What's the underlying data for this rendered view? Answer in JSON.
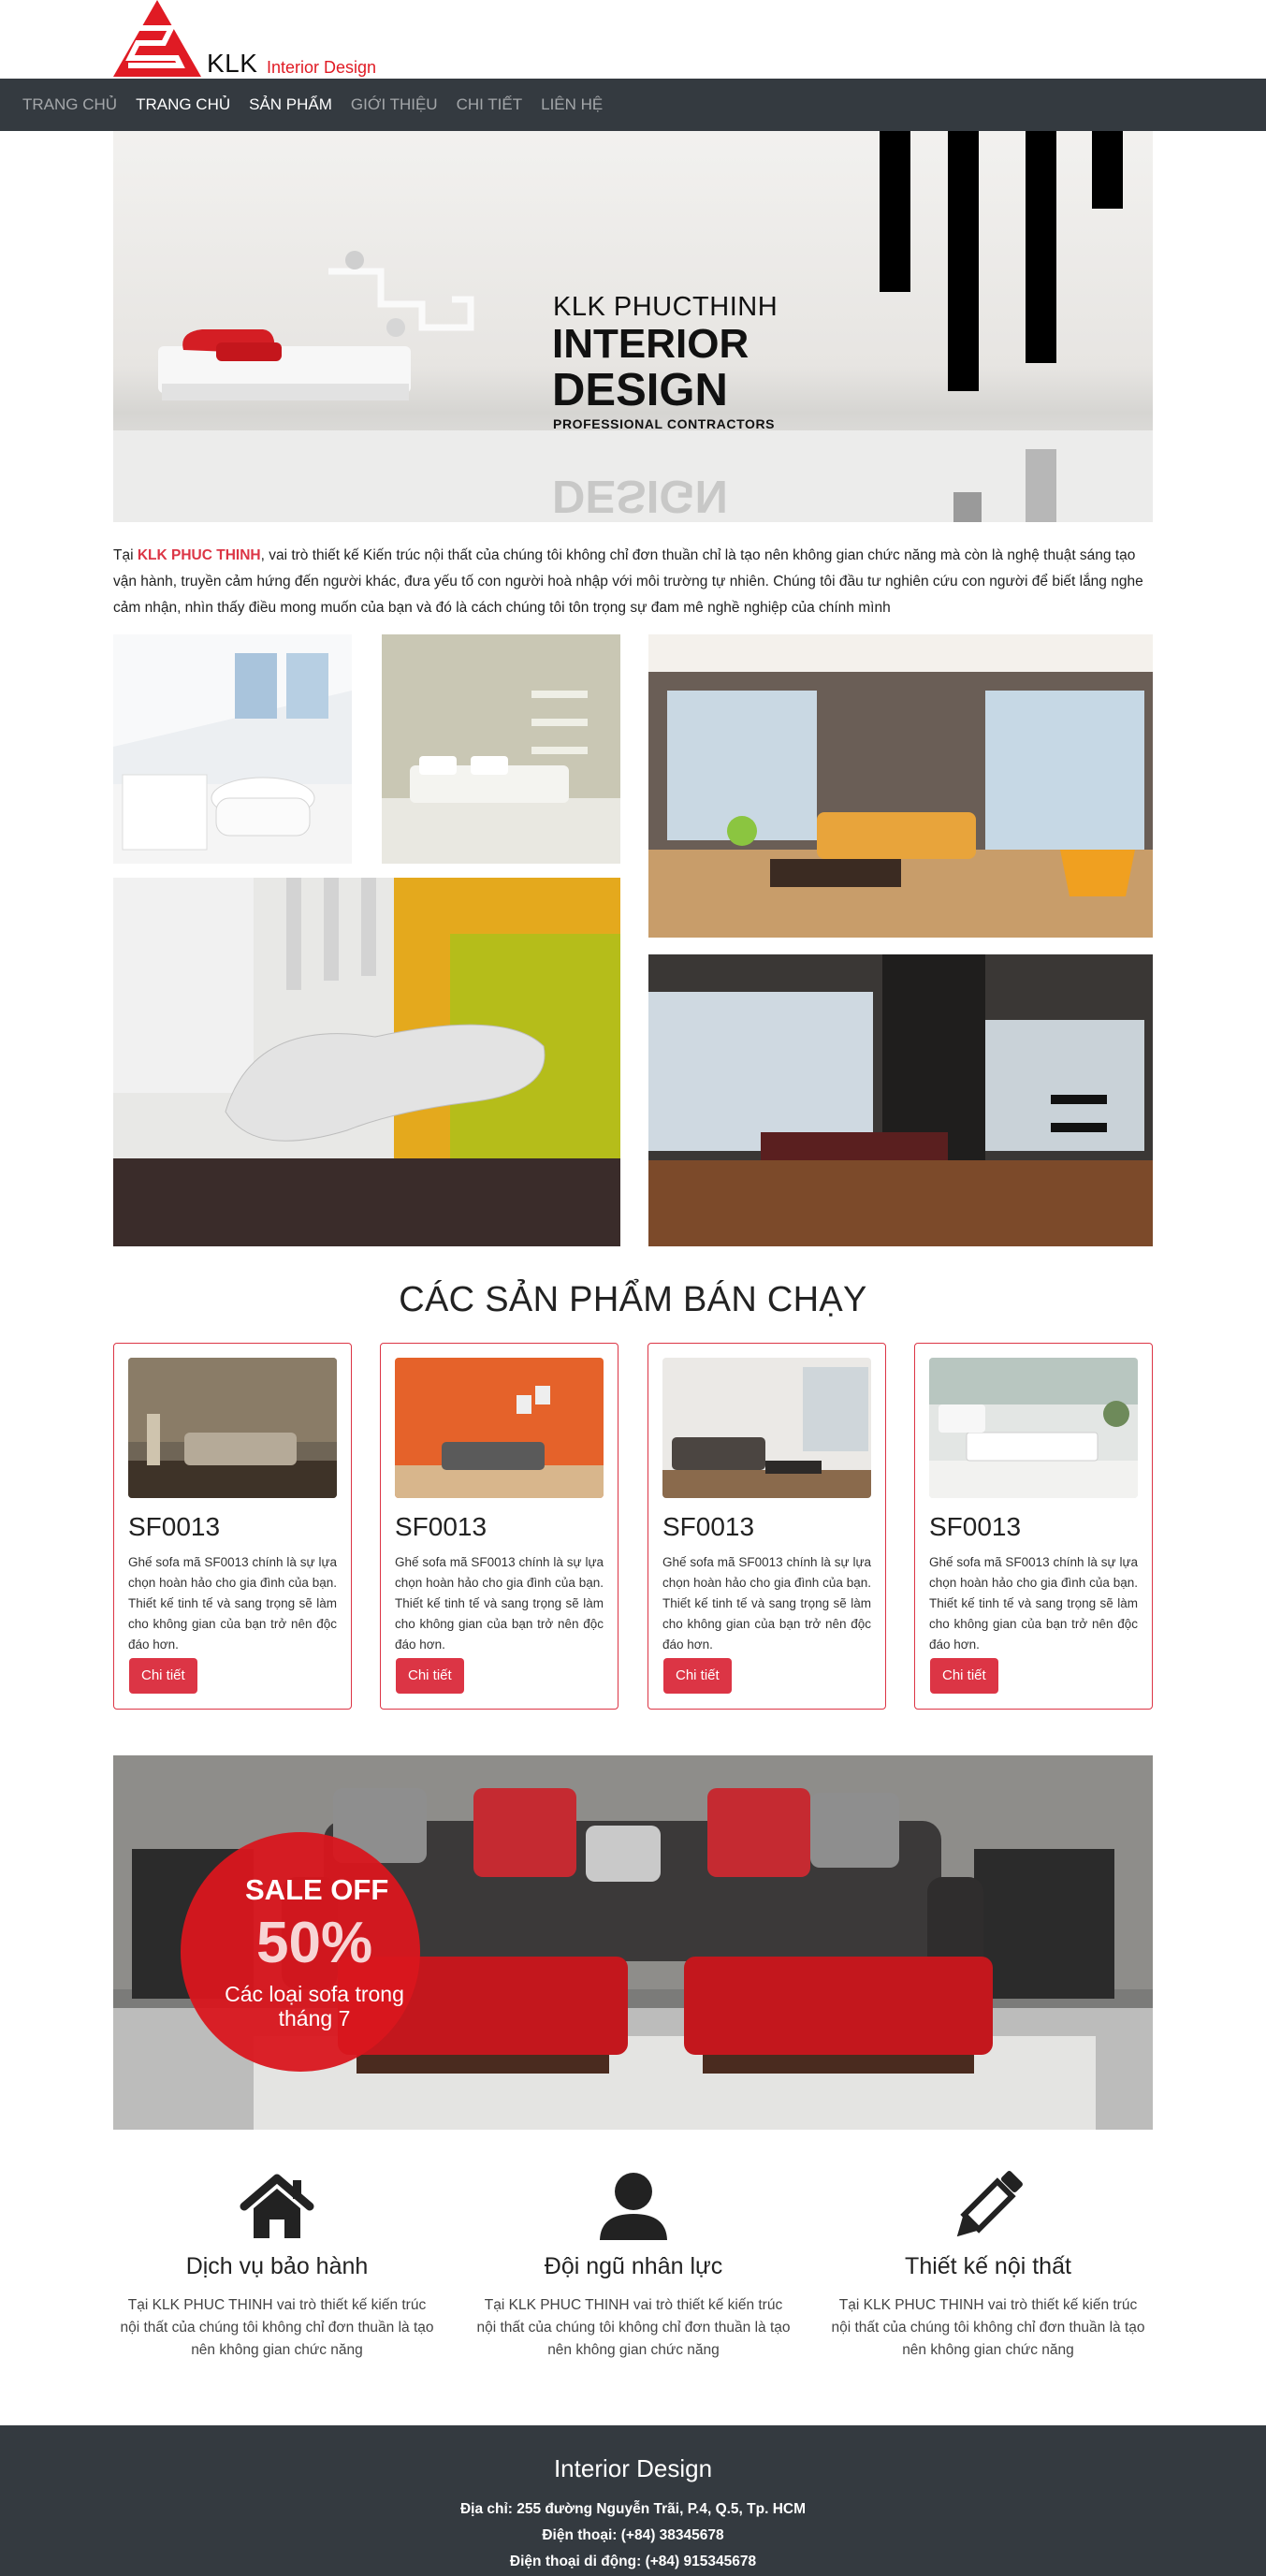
{
  "brand": {
    "name": "KLK",
    "tagline": "Interior Design",
    "accent_color": "#dc3545",
    "nav_color": "#343a40"
  },
  "nav": {
    "brand_label": "TRANG CHỦ",
    "items": [
      {
        "label": "TRANG CHỦ",
        "active": true
      },
      {
        "label": "SẢN PHẨM",
        "active": true
      },
      {
        "label": "GIỚI THIỆU",
        "active": false
      },
      {
        "label": "CHI TIẾT",
        "active": false
      },
      {
        "label": "LIÊN HỆ",
        "active": false
      }
    ]
  },
  "hero": {
    "line1": "KLK PHUCTHINH",
    "line2": "INTERIOR",
    "line3": "DESIGN",
    "line4": "PROFESSIONAL CONTRACTORS",
    "reflection": "DESIGN"
  },
  "intro": {
    "prefix": "Tại ",
    "brand": "KLK PHUC THINH",
    "text": ", vai trò thiết kế Kiến trúc nội thất của chúng tôi không chỉ đơn thuần chỉ là tạo nên không gian chức năng mà còn là nghệ thuật sáng tạo vận hành, truyền cảm hứng đến người khác, đưa yếu tố con người hoà nhập với môi trường tự nhiên. Chúng tôi đầu tư nghiên cứu con người để biết lắng nghe cảm nhận, nhìn thấy điều mong muốn của bạn và đó là cách chúng tôi tôn trọng sự đam mê nghề nghiệp của chính mình"
  },
  "products": {
    "title": "CÁC SẢN PHẨM BÁN CHẠY",
    "items": [
      {
        "code": "SF0013",
        "desc": "Ghế sofa mã SF0013 chính là sự lựa chọn hoàn hảo cho gia đình của bạn. Thiết kế tinh tế và sang trọng sẽ làm cho không gian của bạn trở nên độc đáo hơn.",
        "button": "Chi tiết"
      },
      {
        "code": "SF0013",
        "desc": "Ghế sofa mã SF0013 chính là sự lựa chọn hoàn hảo cho gia đình của bạn. Thiết kế tinh tế và sang trọng sẽ làm cho không gian của bạn trở nên độc đáo hơn.",
        "button": "Chi tiết"
      },
      {
        "code": "SF0013",
        "desc": "Ghế sofa mã SF0013 chính là sự lựa chọn hoàn hảo cho gia đình của bạn. Thiết kế tinh tế và sang trọng sẽ làm cho không gian của bạn trở nên độc đáo hơn.",
        "button": "Chi tiết"
      },
      {
        "code": "SF0013",
        "desc": "Ghế sofa mã SF0013 chính là sự lựa chọn hoàn hảo cho gia đình của bạn. Thiết kế tinh tế và sang trọng sẽ làm cho không gian của bạn trở nên độc đáo hơn.",
        "button": "Chi tiết"
      }
    ]
  },
  "sale": {
    "line1": "SALE OFF",
    "line2": "50%",
    "line3": "Các loại sofa trong tháng 7"
  },
  "features": [
    {
      "icon": "home-icon",
      "title": "Dịch vụ bảo hành",
      "text": "Tại KLK PHUC THINH vai trò thiết kế kiến trúc nội thất của chúng tôi không chỉ đơn thuần là tạo nên không gian chức năng"
    },
    {
      "icon": "user-icon",
      "title": "Đội ngũ nhân lực",
      "text": "Tại KLK PHUC THINH vai trò thiết kế kiến trúc nội thất của chúng tôi không chỉ đơn thuần là tạo nên không gian chức năng"
    },
    {
      "icon": "pencil-icon",
      "title": "Thiết kế nội thất",
      "text": "Tại KLK PHUC THINH vai trò thiết kế kiến trúc nội thất của chúng tôi không chỉ đơn thuần là tạo nên không gian chức năng"
    }
  ],
  "footer": {
    "title": "Interior Design",
    "address": "Địa chỉ: 255 đường Nguyễn Trãi, P.4, Q.5, Tp. HCM",
    "phone": "Điện thoại: (+84) 38345678",
    "mobile": "Điện thoại di động: (+84) 915345678"
  }
}
